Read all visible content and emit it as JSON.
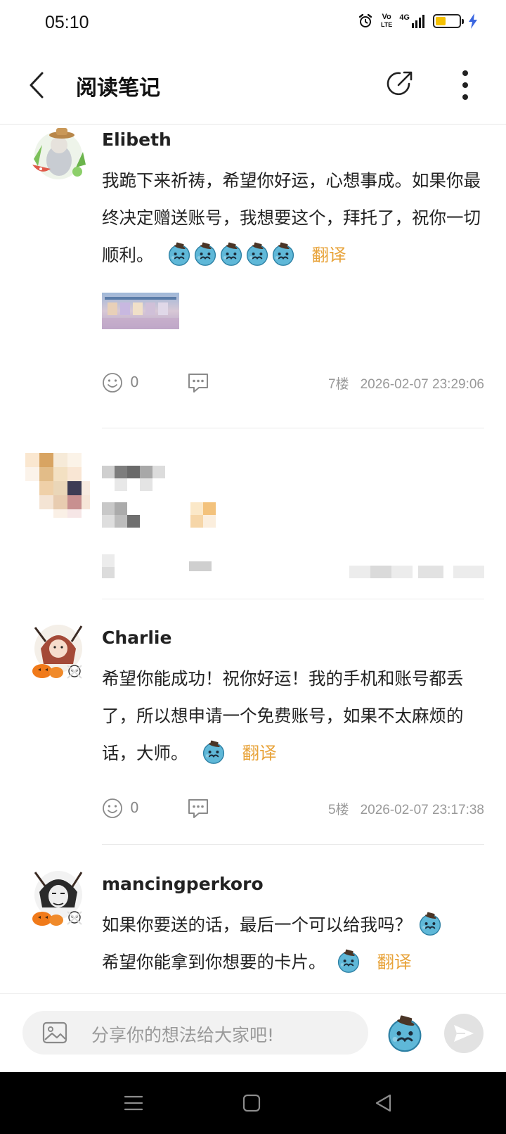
{
  "status_bar": {
    "time": "05:10",
    "network_label_top": "Vo",
    "network_label_bottom": "LTE",
    "signal_label": "4G",
    "battery_percent": 42,
    "battery_color": "#f4c000",
    "charging_color": "#3a66e0"
  },
  "header": {
    "title": "阅读笔记",
    "back_icon": "chevron-left-icon",
    "share_icon": "share-icon",
    "more_icon": "more-vertical-icon"
  },
  "comments": [
    {
      "username": "Elibeth",
      "text": "我跪下来祈祷，希望你好运，心想事成。如果你最终决定赠送账号，我想要这个，拜托了，祝你一切顺利。",
      "emoji_count": 5,
      "translate_label": "翻译",
      "has_image": true,
      "likes": "0",
      "floor": "7楼",
      "timestamp": "2026-02-07 23:29:06"
    },
    {
      "username": "Charlie",
      "text": "希望你能成功！祝你好运！我的手机和账号都丢了，所以想申请一个免费账号，如果不太麻烦的话，大师。",
      "emoji_count": 1,
      "translate_label": "翻译",
      "likes": "0",
      "floor": "5楼",
      "timestamp": "2026-02-07 23:17:38"
    },
    {
      "username": "mancingperkoro",
      "text_line1": "如果你要送的话，最后一个可以给我吗？",
      "text_line2": "希望你能拿到你想要的卡片。",
      "translate_label": "翻译"
    }
  ],
  "input_bar": {
    "placeholder": "分享你的想法给大家吧!",
    "image_icon": "image-icon",
    "emoji_icon": "emoji-icon",
    "send_icon": "send-icon"
  },
  "nav_bar": {
    "menu_icon": "menu-icon",
    "home_icon": "home-icon",
    "back_icon": "back-triangle-icon"
  }
}
